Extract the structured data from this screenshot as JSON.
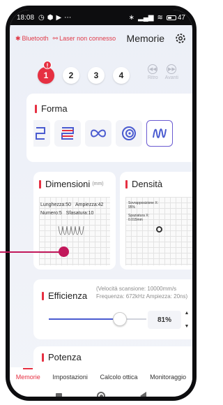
{
  "status_bar": {
    "time": "18:08",
    "battery": "47"
  },
  "header": {
    "bluetooth_label": "Bluetooth",
    "laser_label": "Laser non connesso",
    "title": "Memorie"
  },
  "steps": {
    "items": [
      "1",
      "2",
      "3",
      "4"
    ],
    "active": "1",
    "alert_badge": "!"
  },
  "nav_buttons": {
    "back_label": "Ritro",
    "forward_label": "Avanti"
  },
  "forma": {
    "title": "Forma",
    "shapes": [
      "zigzag-partial-icon",
      "zigzag-red-icon",
      "infinity-icon",
      "spiral-icon",
      "wave-selected-icon"
    ]
  },
  "dimensioni": {
    "title": "Dimensioni",
    "unit": "(mm)",
    "lunghezza": "Lunghezza:50",
    "ampiezza": "Ampiezza:42",
    "numero": "Numero:5",
    "sfasatura": "Sfasatura:10"
  },
  "densita": {
    "title": "Densità",
    "sovrapposizione_label": "Sovrapposizione X:",
    "sovrapposizione_value": "95%",
    "spaziatura_label": "Spaziatura X:",
    "spaziatura_value": "0.015mm"
  },
  "efficienza": {
    "title": "Efficienza",
    "info_line1": "(Velocità scansione:  10000mm/s",
    "info_line2": "Frequenza:  672kHz Ampiezza:  20ns)",
    "percent": "81%",
    "level": 0.81
  },
  "potenza": {
    "title": "Potenza"
  },
  "tabbar": {
    "tabs": [
      "Memorie",
      "Impostazioni",
      "Calcolo ottica",
      "Monitoraggio"
    ],
    "active": "Memorie"
  },
  "colors": {
    "accent": "#e63042",
    "slider": "#4a5bd0",
    "pointer": "#c2185b",
    "selected_border": "#6a5ad1"
  }
}
